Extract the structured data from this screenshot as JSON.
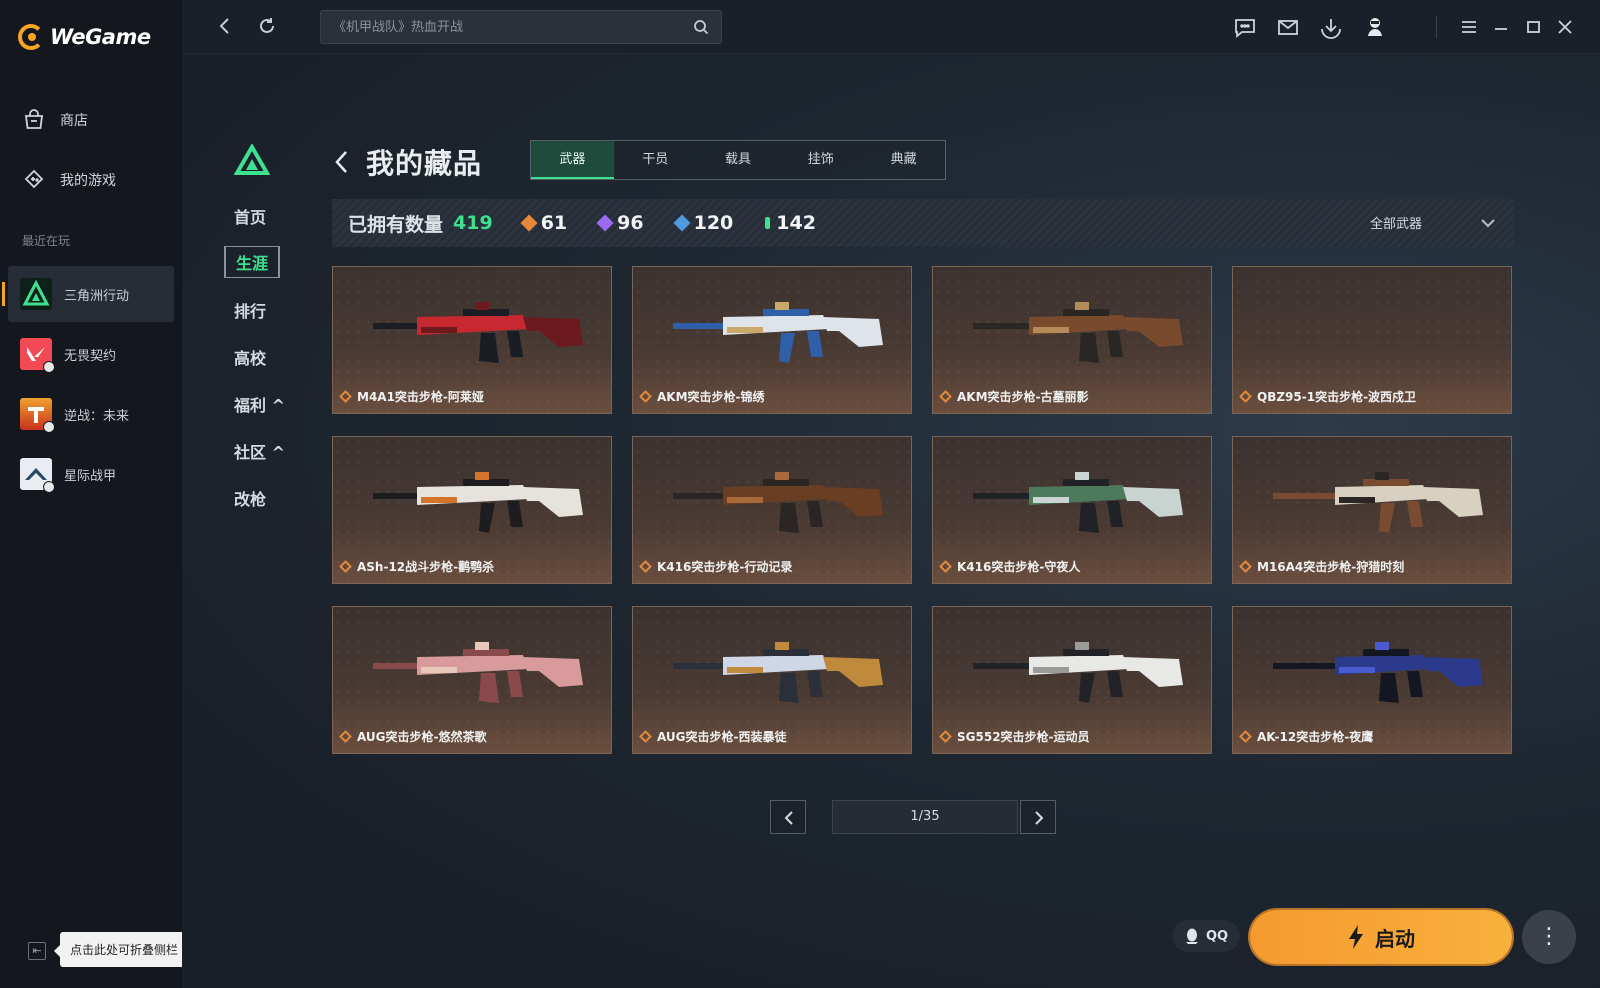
{
  "app": {
    "name": "WeGame",
    "brand_color": "#f5a623",
    "accent_color": "#3fe08f"
  },
  "sidebar": {
    "nav": [
      {
        "label": "商店",
        "icon": "store-bag-icon"
      },
      {
        "label": "我的游戏",
        "icon": "gamepad-icon"
      }
    ],
    "recent_label": "最近在玩",
    "recent": [
      {
        "label": "三角洲行动",
        "icon": "delta-force-icon",
        "active": true
      },
      {
        "label": "无畏契约",
        "icon": "valorant-icon"
      },
      {
        "label": "逆战：未来",
        "icon": "nizhan-icon"
      },
      {
        "label": "星际战甲",
        "icon": "warframe-icon"
      }
    ],
    "collapse_tooltip": "点击此处可折叠侧栏"
  },
  "topbar": {
    "search_placeholder": "《机甲战队》热血开战",
    "icons": [
      "back-icon",
      "refresh-icon",
      "search-icon",
      "chat-icon",
      "mail-icon",
      "download-icon",
      "avatar-icon",
      "menu-icon",
      "minimize-icon",
      "maximize-icon",
      "close-icon"
    ]
  },
  "subnav": {
    "items": [
      {
        "label": "首页"
      },
      {
        "label": "生涯",
        "active": true
      },
      {
        "label": "排行"
      },
      {
        "label": "高校"
      },
      {
        "label": "福利 ^"
      },
      {
        "label": "社区 ^"
      },
      {
        "label": "改枪"
      }
    ]
  },
  "collection": {
    "title": "我的藏品",
    "tabs": [
      "武器",
      "干员",
      "载具",
      "挂饰",
      "典藏"
    ],
    "active_tab": "武器",
    "owned_label": "已拥有数量",
    "owned_count": "419",
    "rarity_counts": [
      {
        "value": "61",
        "color": "#e8873a"
      },
      {
        "value": "96",
        "color": "#9b6cf0"
      },
      {
        "value": "120",
        "color": "#4d9ae0"
      },
      {
        "value": "142",
        "color": "#3fe08f"
      }
    ],
    "filter_label": "全部武器",
    "items": [
      {
        "name": "M4A1突击步枪-阿莱娅",
        "palette": [
          "#c8282f",
          "#1b1d24",
          "#6d1a1f"
        ]
      },
      {
        "name": "AKM突击步枪-锦绣",
        "palette": [
          "#dfe4ea",
          "#2f5fa8",
          "#c9a86a"
        ]
      },
      {
        "name": "AKM突击步枪-古墓丽影",
        "palette": [
          "#7a4a2c",
          "#2a2624",
          "#b58a5a"
        ]
      },
      {
        "name": "QBZ95-1突击步枪-波西戍卫",
        "palette": [
          "#3b3230",
          "#3b3230",
          "#3b3230"
        ]
      },
      {
        "name": "ASh-12战斗步枪-鹳鹗杀",
        "palette": [
          "#e6e3dd",
          "#1d1d20",
          "#d4742a"
        ]
      },
      {
        "name": "K416突击步枪-行动记录",
        "palette": [
          "#6a3e22",
          "#2b2523",
          "#a86a3a"
        ]
      },
      {
        "name": "K416突击步枪-守夜人",
        "palette": [
          "#4c7a5a",
          "#1f2325",
          "#c9d3cf"
        ]
      },
      {
        "name": "M16A4突击步枪-狩猎时刻",
        "palette": [
          "#d8d1c2",
          "#7a4b30",
          "#2a2624"
        ]
      },
      {
        "name": "AUG突击步枪-悠然茶歌",
        "palette": [
          "#d89a9a",
          "#8a4a4c",
          "#e8c8b8"
        ]
      },
      {
        "name": "AUG突击步枪-西装暴徒",
        "palette": [
          "#cfd7e6",
          "#2b2f3a",
          "#c08a3c"
        ]
      },
      {
        "name": "SG552突击步枪-运动员",
        "palette": [
          "#e8e8e6",
          "#222326",
          "#9a9a98"
        ]
      },
      {
        "name": "AK-12突击步枪-夜鹰",
        "palette": [
          "#2b3a8c",
          "#141622",
          "#4a5ad0"
        ]
      }
    ]
  },
  "pagination": {
    "label": "1/35"
  },
  "launch": {
    "qq_label": "QQ",
    "start_label": "启动",
    "more_label": "⋮"
  }
}
